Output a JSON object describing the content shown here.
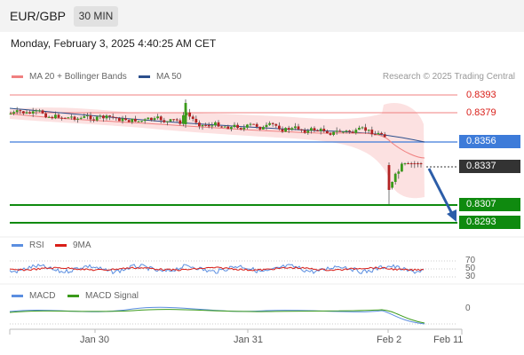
{
  "header": {
    "symbol": "EUR/GBP",
    "timeframe": "30 MIN"
  },
  "datetime": "Monday, February 3, 2025 4:40:25 AM CET",
  "legend": {
    "ma20_label": "MA 20 + Bollinger Bands",
    "ma50_label": "MA 50",
    "credit": "Research © 2025 Trading Central"
  },
  "price_levels": {
    "r2": "0.8393",
    "r1": "0.8379",
    "pivot": "0.8356",
    "last": "0.8337",
    "s1": "0.8307",
    "s2": "0.8293"
  },
  "rsi": {
    "rsi_label": "RSI",
    "ma_label": "9MA",
    "levels": [
      "70",
      "50",
      "30"
    ]
  },
  "macd": {
    "macd_label": "MACD",
    "signal_label": "MACD Signal",
    "zero_label": "0"
  },
  "x_axis": [
    "Jan 30",
    "Jan 31",
    "Feb 2",
    "Feb 11"
  ],
  "colors": {
    "resistance": "#f08080",
    "pivot": "#3d7bd9",
    "support": "#0f8a0f",
    "last": "#333333",
    "arrow": "#2c5da8",
    "bollinger": "#fbdcdc"
  }
}
